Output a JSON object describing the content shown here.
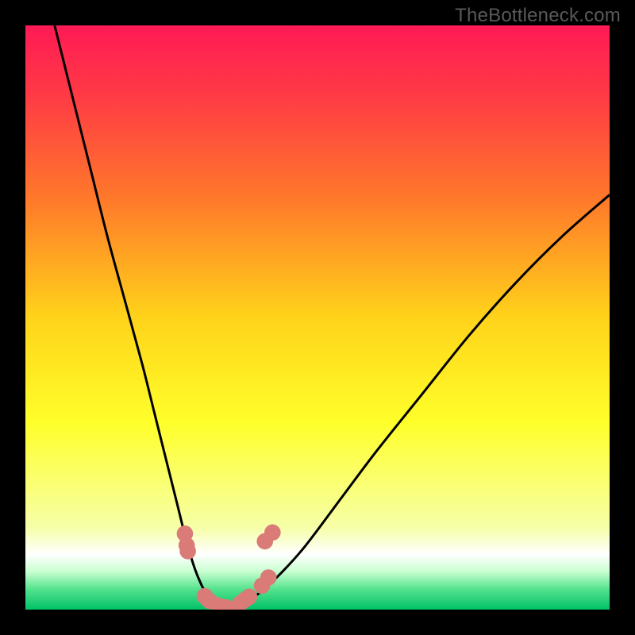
{
  "watermark": "TheBottleneck.com",
  "colors": {
    "frame": "#000000",
    "curve": "#000000",
    "marker_fill": "#da7b78",
    "gradient_stops": [
      {
        "offset": 0.0,
        "color": "#ff1a55"
      },
      {
        "offset": 0.12,
        "color": "#ff3a45"
      },
      {
        "offset": 0.3,
        "color": "#ff7a2a"
      },
      {
        "offset": 0.5,
        "color": "#ffd31a"
      },
      {
        "offset": 0.68,
        "color": "#ffff2a"
      },
      {
        "offset": 0.86,
        "color": "#f6ffa8"
      },
      {
        "offset": 0.905,
        "color": "#ffffff"
      },
      {
        "offset": 0.935,
        "color": "#c8ffd0"
      },
      {
        "offset": 0.965,
        "color": "#55e28e"
      },
      {
        "offset": 1.0,
        "color": "#00c268"
      }
    ]
  },
  "chart_data": {
    "type": "line",
    "title": "",
    "xlabel": "",
    "ylabel": "",
    "xlim": [
      0,
      100
    ],
    "ylim": [
      0,
      100
    ],
    "series": [
      {
        "name": "bottleneck-curve",
        "x": [
          5,
          8,
          11,
          14,
          17,
          20,
          22,
          24,
          26,
          27.5,
          29,
          30.5,
          32,
          34,
          36,
          40,
          44,
          48,
          54,
          60,
          68,
          76,
          84,
          92,
          100
        ],
        "values": [
          100,
          88,
          76,
          64,
          53,
          42,
          34,
          26,
          18,
          12,
          7,
          3.5,
          1.2,
          0.3,
          0.6,
          2.8,
          6.5,
          11,
          19,
          27,
          37,
          47,
          56,
          64,
          71
        ]
      }
    ],
    "markers": [
      {
        "x": 27.3,
        "y": 13.0,
        "r": 1.4
      },
      {
        "x": 27.6,
        "y": 11.0,
        "r": 1.4
      },
      {
        "x": 27.8,
        "y": 10.0,
        "r": 1.4
      },
      {
        "x": 30.7,
        "y": 2.3,
        "r": 1.4
      },
      {
        "x": 31.5,
        "y": 1.5,
        "r": 1.4
      },
      {
        "x": 33.0,
        "y": 0.7,
        "r": 1.4
      },
      {
        "x": 34.3,
        "y": 0.4,
        "r": 1.4
      },
      {
        "x": 36.7,
        "y": 1.0,
        "r": 1.4
      },
      {
        "x": 37.6,
        "y": 1.7,
        "r": 1.4
      },
      {
        "x": 38.3,
        "y": 2.2,
        "r": 1.4
      },
      {
        "x": 40.5,
        "y": 4.1,
        "r": 1.4
      },
      {
        "x": 41.6,
        "y": 5.5,
        "r": 1.4
      },
      {
        "x": 41.0,
        "y": 11.7,
        "r": 1.4
      },
      {
        "x": 42.3,
        "y": 13.2,
        "r": 1.4
      }
    ]
  }
}
